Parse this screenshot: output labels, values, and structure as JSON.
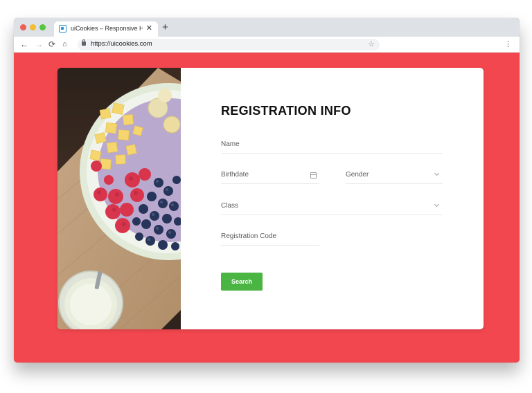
{
  "browser": {
    "tab_title": "uiCookies – Responsive HTML",
    "tab_close": "✕",
    "new_tab": "+",
    "url": "https://uicookies.com",
    "nav": {
      "back": "←",
      "forward": "→",
      "reload": "⟳",
      "home": "⌂"
    },
    "bookmark": "☆",
    "menu": "⋮"
  },
  "form": {
    "title": "REGISTRATION INFO",
    "fields": {
      "name": "Name",
      "birthdate": "Birthdate",
      "gender": "Gender",
      "class": "Class",
      "registration_code": "Registration Code"
    },
    "submit": "Search"
  },
  "colors": {
    "page_background": "#f3474f",
    "button": "#4bb543"
  },
  "icons": [
    "favicon-icon",
    "back-icon",
    "forward-icon",
    "reload-icon",
    "home-icon",
    "lock-icon",
    "star-icon",
    "menu-icon",
    "calendar-icon",
    "chevron-down-icon"
  ]
}
